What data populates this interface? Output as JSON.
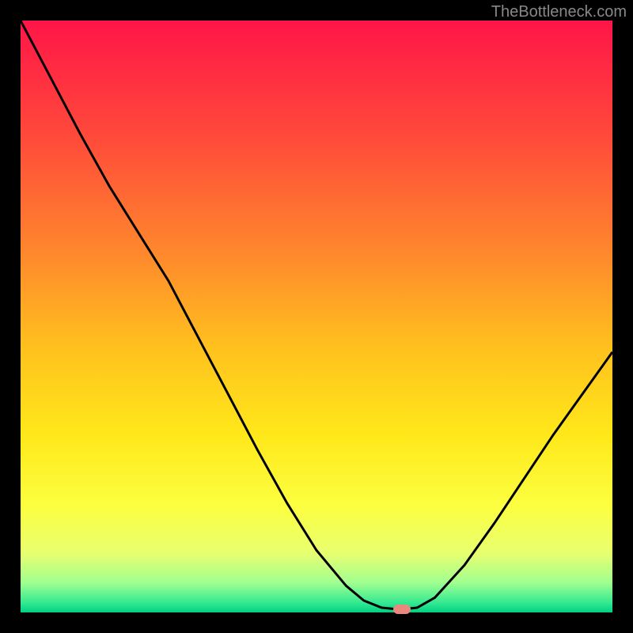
{
  "watermark": "TheBottleneck.com",
  "chart_data": {
    "type": "line",
    "x": [
      0.0,
      0.05,
      0.1,
      0.15,
      0.2,
      0.25,
      0.3,
      0.35,
      0.4,
      0.45,
      0.5,
      0.55,
      0.58,
      0.61,
      0.64,
      0.67,
      0.7,
      0.75,
      0.8,
      0.85,
      0.9,
      0.95,
      1.0
    ],
    "values": [
      1.0,
      0.905,
      0.81,
      0.72,
      0.64,
      0.56,
      0.465,
      0.37,
      0.275,
      0.185,
      0.105,
      0.045,
      0.02,
      0.008,
      0.005,
      0.008,
      0.025,
      0.08,
      0.15,
      0.225,
      0.3,
      0.37,
      0.44
    ],
    "xlim": [
      0,
      1
    ],
    "ylim": [
      0,
      1
    ],
    "marker_x": 0.645,
    "marker_y": 0.006,
    "background_gradient_stops": [
      {
        "offset": 0.0,
        "color": "#ff1548"
      },
      {
        "offset": 0.2,
        "color": "#ff4b3a"
      },
      {
        "offset": 0.4,
        "color": "#ff8a2c"
      },
      {
        "offset": 0.55,
        "color": "#ffc01e"
      },
      {
        "offset": 0.7,
        "color": "#ffe81a"
      },
      {
        "offset": 0.82,
        "color": "#fcff40"
      },
      {
        "offset": 0.9,
        "color": "#e8ff70"
      },
      {
        "offset": 0.95,
        "color": "#a0ff90"
      },
      {
        "offset": 0.985,
        "color": "#30e890"
      },
      {
        "offset": 1.0,
        "color": "#00d080"
      }
    ]
  }
}
